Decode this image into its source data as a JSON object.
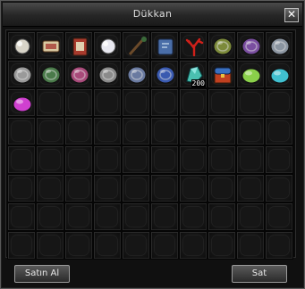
{
  "window": {
    "title": "Dükkan"
  },
  "buttons": {
    "buy_label": "Satın Al",
    "sell_label": "Sat"
  },
  "grid": {
    "columns": 10,
    "rows": 8,
    "items": [
      {
        "name": "pearl-stone",
        "color": "#d8d4c8"
      },
      {
        "name": "scroll",
        "color": "#b0584a"
      },
      {
        "name": "red-book",
        "color": "#a83a2c"
      },
      {
        "name": "white-orb",
        "color": "#e8e8f0"
      },
      {
        "name": "wooden-staff",
        "color": "#6b4a2a"
      },
      {
        "name": "blue-rune-book",
        "color": "#4a6ea8"
      },
      {
        "name": "red-coral",
        "color": "#d0201a"
      },
      {
        "name": "olive-ring-stone",
        "color": "#7c8a3a"
      },
      {
        "name": "purple-ring-stone",
        "color": "#7a4ea0"
      },
      {
        "name": "silver-ring-stone",
        "color": "#8a94a0"
      },
      {
        "name": "gray-ring-stone",
        "color": "#9a9a9a"
      },
      {
        "name": "green-ring-stone",
        "color": "#4a7a4a"
      },
      {
        "name": "pink-ring-stone",
        "color": "#a84a7a"
      },
      {
        "name": "gray-ring-stone",
        "color": "#8a8a8a"
      },
      {
        "name": "blue-gray-ring-stone",
        "color": "#6a7aa0"
      },
      {
        "name": "blue-rune-stone",
        "color": "#3a5ab0"
      },
      {
        "name": "crystal-shard",
        "color": "#4ac0b0",
        "count": "200"
      },
      {
        "name": "treasure-chest",
        "color": "#c04020"
      },
      {
        "name": "green-slime-gem",
        "color": "#8ad04a"
      },
      {
        "name": "cyan-gem",
        "color": "#40c0d0"
      },
      {
        "name": "magenta-gem",
        "color": "#d040d0"
      }
    ]
  }
}
